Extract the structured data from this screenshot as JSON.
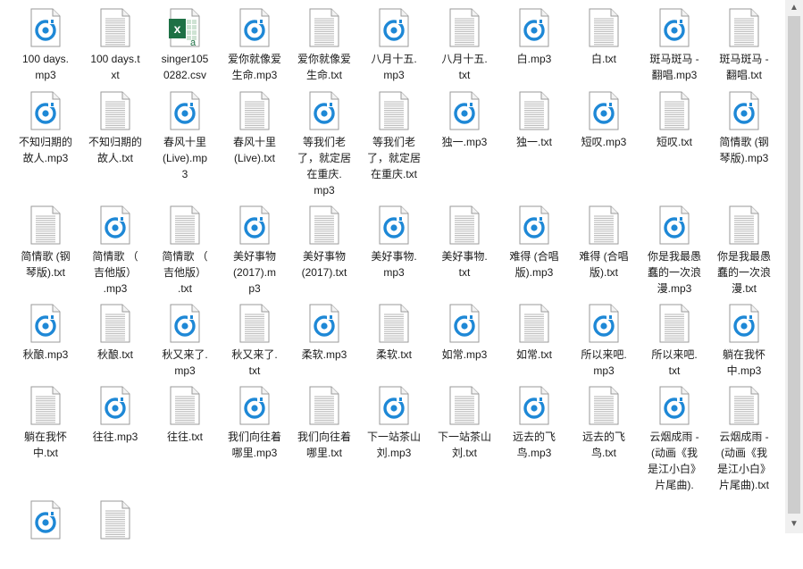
{
  "colors": {
    "accent": "#1e88d6",
    "excel": "#1e7145",
    "text": "#1b1b1b"
  },
  "icons": {
    "audio": "music-file-icon",
    "text": "text-file-icon",
    "csv": "excel-file-icon"
  },
  "scrollbar": {
    "up": "▲",
    "down": "▼"
  },
  "files": [
    {
      "name": "100 days.\nmp3",
      "type": "audio"
    },
    {
      "name": "100 days.t\nxt",
      "type": "text"
    },
    {
      "name": "singer105\n0282.csv",
      "type": "csv"
    },
    {
      "name": "爱你就像爱\n生命.mp3",
      "type": "audio"
    },
    {
      "name": "爱你就像爱\n生命.txt",
      "type": "text"
    },
    {
      "name": "八月十五.\nmp3",
      "type": "audio"
    },
    {
      "name": "八月十五.\ntxt",
      "type": "text"
    },
    {
      "name": "白.mp3",
      "type": "audio"
    },
    {
      "name": "白.txt",
      "type": "text"
    },
    {
      "name": "斑马斑马 -\n翻唱.mp3",
      "type": "audio"
    },
    {
      "name": "斑马斑马 -\n翻唱.txt",
      "type": "text"
    },
    {
      "name": "不知归期的\n故人.mp3",
      "type": "audio"
    },
    {
      "name": "不知归期的\n故人.txt",
      "type": "text"
    },
    {
      "name": "春风十里\n(Live).mp\n3",
      "type": "audio"
    },
    {
      "name": "春风十里\n(Live).txt",
      "type": "text"
    },
    {
      "name": "等我们老\n了，就定居\n在重庆.\nmp3",
      "type": "audio"
    },
    {
      "name": "等我们老\n了，就定居\n在重庆.txt",
      "type": "text"
    },
    {
      "name": "独一.mp3",
      "type": "audio"
    },
    {
      "name": "独一.txt",
      "type": "text"
    },
    {
      "name": "短叹.mp3",
      "type": "audio"
    },
    {
      "name": "短叹.txt",
      "type": "text"
    },
    {
      "name": "简情歌 (钢\n琴版).mp3",
      "type": "audio"
    },
    {
      "name": "简情歌 (钢\n琴版).txt",
      "type": "text"
    },
    {
      "name": "简情歌 （\n吉他版）\n.mp3",
      "type": "audio"
    },
    {
      "name": "简情歌 （\n吉他版）\n.txt",
      "type": "text"
    },
    {
      "name": "美好事物\n(2017).m\np3",
      "type": "audio"
    },
    {
      "name": "美好事物\n(2017).txt",
      "type": "text"
    },
    {
      "name": "美好事物.\nmp3",
      "type": "audio"
    },
    {
      "name": "美好事物.\ntxt",
      "type": "text"
    },
    {
      "name": "难得 (合唱\n版).mp3",
      "type": "audio"
    },
    {
      "name": "难得 (合唱\n版).txt",
      "type": "text"
    },
    {
      "name": "你是我最愚\n蠢的一次浪\n漫.mp3",
      "type": "audio"
    },
    {
      "name": "你是我最愚\n蠢的一次浪\n漫.txt",
      "type": "text"
    },
    {
      "name": "秋酿.mp3",
      "type": "audio"
    },
    {
      "name": "秋酿.txt",
      "type": "text"
    },
    {
      "name": "秋又来了.\nmp3",
      "type": "audio"
    },
    {
      "name": "秋又来了.\ntxt",
      "type": "text"
    },
    {
      "name": "柔软.mp3",
      "type": "audio"
    },
    {
      "name": "柔软.txt",
      "type": "text"
    },
    {
      "name": "如常.mp3",
      "type": "audio"
    },
    {
      "name": "如常.txt",
      "type": "text"
    },
    {
      "name": "所以来吧.\nmp3",
      "type": "audio"
    },
    {
      "name": "所以来吧.\ntxt",
      "type": "text"
    },
    {
      "name": "躺在我怀\n中.mp3",
      "type": "audio"
    },
    {
      "name": "躺在我怀\n中.txt",
      "type": "text"
    },
    {
      "name": "往往.mp3",
      "type": "audio"
    },
    {
      "name": "往往.txt",
      "type": "text"
    },
    {
      "name": "我们向往着\n哪里.mp3",
      "type": "audio"
    },
    {
      "name": "我们向往着\n哪里.txt",
      "type": "text"
    },
    {
      "name": "下一站茶山\n刘.mp3",
      "type": "audio"
    },
    {
      "name": "下一站茶山\n刘.txt",
      "type": "text"
    },
    {
      "name": "远去的飞\n鸟.mp3",
      "type": "audio"
    },
    {
      "name": "远去的飞\n鸟.txt",
      "type": "text"
    },
    {
      "name": "云烟成雨 -\n(动画《我\n是江小白》\n片尾曲).",
      "type": "audio"
    },
    {
      "name": "云烟成雨 -\n(动画《我\n是江小白》\n片尾曲).txt",
      "type": "text"
    },
    {
      "name": "",
      "type": "audio"
    },
    {
      "name": "",
      "type": "text"
    }
  ]
}
